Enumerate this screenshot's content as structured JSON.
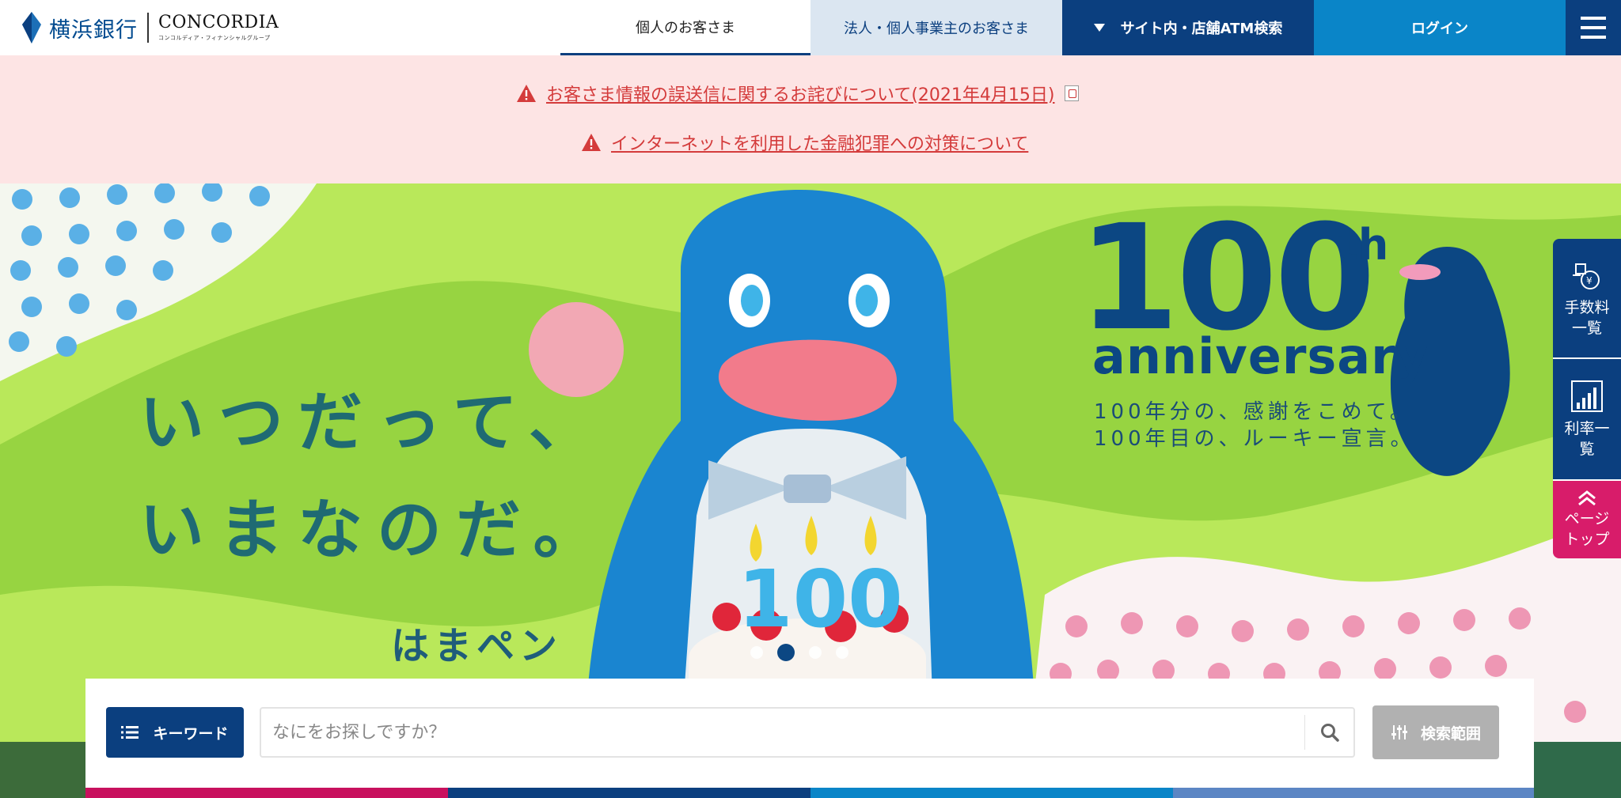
{
  "header": {
    "logo_jp": "横浜銀行",
    "logo_en": "CONCORDIA",
    "logo_en_sub": "コンコルディア・フィナンシャルグループ",
    "nav": {
      "personal": "個人のお客さま",
      "corporate": "法人・個人事業主のお客さま",
      "site_search": "サイト内・店舗ATM検索",
      "login": "ログイン"
    }
  },
  "alerts": [
    {
      "text": "お客さま情報の誤送信に関するお詫びについて(2021年4月15日)",
      "pdf": true
    },
    {
      "text": "インターネットを利用した金融犯罪への対策について",
      "pdf": false
    }
  ],
  "hero": {
    "tagline_line1": "いつだって、",
    "tagline_line2": "いまなのだ。",
    "character_name": "はまペン",
    "cake_number": "100",
    "anniv_number": "100",
    "anniv_suffix": "th",
    "anniv_word": "anniversary",
    "anniv_line1": "100年分の、感謝をこめて。",
    "anniv_line2": "100年目の、ルーキー宣言。",
    "carousel": {
      "count": 4,
      "active_index": 1
    }
  },
  "side_tabs": {
    "fees": "手数料一覧",
    "fees_line1": "手数料",
    "fees_line2": "一覧",
    "rates_line1": "利率一",
    "rates_line2": "覧",
    "page_top_line1": "ページ",
    "page_top_line2": "トップ"
  },
  "search": {
    "keyword_label": "キーワード",
    "placeholder": "なにをお探しですか？",
    "value": "",
    "scope_label": "検索範囲"
  },
  "colors": {
    "navy": "#0b3f7f",
    "blue": "#0a85c8",
    "alert_red": "#d43b3b",
    "alert_bg": "#fde4e4",
    "hero_green": "#b9e85a",
    "pink": "#d81c6a"
  }
}
